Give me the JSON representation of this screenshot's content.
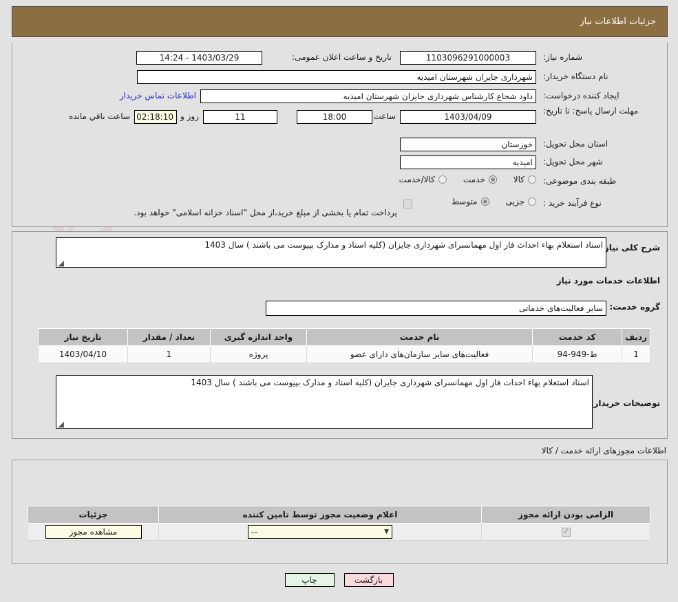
{
  "header": {
    "title": "جزئیات اطلاعات نیاز"
  },
  "need_info": {
    "need_number_label": "شماره نیاز:",
    "need_number_value": "1103096291000003",
    "announce_datetime_label": "تاریخ و ساعت اعلان عمومی:",
    "announce_datetime_value": "1403/03/29 - 14:24",
    "buyer_org_label": "نام دستگاه خریدار:",
    "buyer_org_value": "شهرداری جایزان شهرستان امیدیه",
    "creator_label": "ایجاد کننده درخواست:",
    "creator_value": "داود شجاع کارشناس شهرداری جایزان شهرستان امیدیه",
    "contact_link": "اطلاعات تماس خریدار",
    "deadline_label": "مهلت ارسال پاسخ: تا تاریخ:",
    "deadline_date": "1403/04/09",
    "hour_label": "ساعت",
    "deadline_time": "18:00",
    "days_remaining": "11",
    "days_word": "روز و",
    "countdown": "02:18:10",
    "remaining_suffix": "ساعت باقي مانده",
    "province_label": "استان محل تحویل:",
    "province_value": "خوزستان",
    "city_label": "شهر محل تحویل:",
    "city_value": "امیدیه",
    "classification_label": "طبقه بندی موضوعی:",
    "classification_options": [
      "کالا",
      "خدمت",
      "کالا/خدمت"
    ],
    "classification_selected": "خدمت",
    "purchase_type_label": "نوع فرآیند خرید :",
    "purchase_type_options": [
      "جزیی",
      "متوسط"
    ],
    "purchase_type_selected": "متوسط",
    "treasury_note": "پرداخت تمام یا بخشی از مبلغ خرید،از محل \"اسناد خزانه اسلامی\" خواهد بود.",
    "treasury_checked": false
  },
  "summary": {
    "label": "شرح کلی نیاز:",
    "value": "اسناد استعلام بهاء احداث فاز اول مهمانسرای شهرداری جایزان (کلیه اسناد و مدارک بپیوست می باشند ) سال 1403"
  },
  "services_section": {
    "title": "اطلاعات خدمات مورد نیاز",
    "service_group_label": "گروه خدمت:",
    "service_group_value": "سایر فعالیت‌های خدماتی",
    "columns": [
      "ردیف",
      "کد خدمت",
      "نام خدمت",
      "واحد اندازه گیری",
      "تعداد / مقدار",
      "تاریخ نیاز"
    ],
    "rows": [
      {
        "index": "1",
        "code": "ط-949-94",
        "name": "فعالیت‌های سایر سازمان‌های دارای عضو",
        "unit": "پروژه",
        "quantity": "1",
        "need_date": "1403/04/10"
      }
    ]
  },
  "buyer_notes": {
    "label": "توضیحات خریدار:",
    "value": "اسناد استعلام بهاء احداث فاز اول مهمانسرای شهرداری جایزان (کلیه اسناد و مدارک بپیوست می باشند ) سال 1403"
  },
  "permits_section": {
    "title": "اطلاعات مجوزهای ارائه خدمت / کالا",
    "columns": [
      "الزامی بودن ارائه مجوز",
      "اعلام وضعیت مجوز توسط تامین کننده",
      "جزئیات"
    ],
    "rows": [
      {
        "required_checked": true,
        "status_value": "--",
        "details_button": "مشاهده مجوز"
      }
    ]
  },
  "footer": {
    "print_button": "چاپ",
    "back_button": "بازگشت"
  },
  "watermark": {
    "text": "AriaTender.net"
  },
  "colors": {
    "header_brown": "#8c6e42",
    "page_bg": "#e2e2e2",
    "table_header": "#c3c3c3",
    "link_blue": "#2a2ad0",
    "cream": "#fcfce4",
    "green_button": "#e4f5e4",
    "pink_button": "#fadadd"
  }
}
